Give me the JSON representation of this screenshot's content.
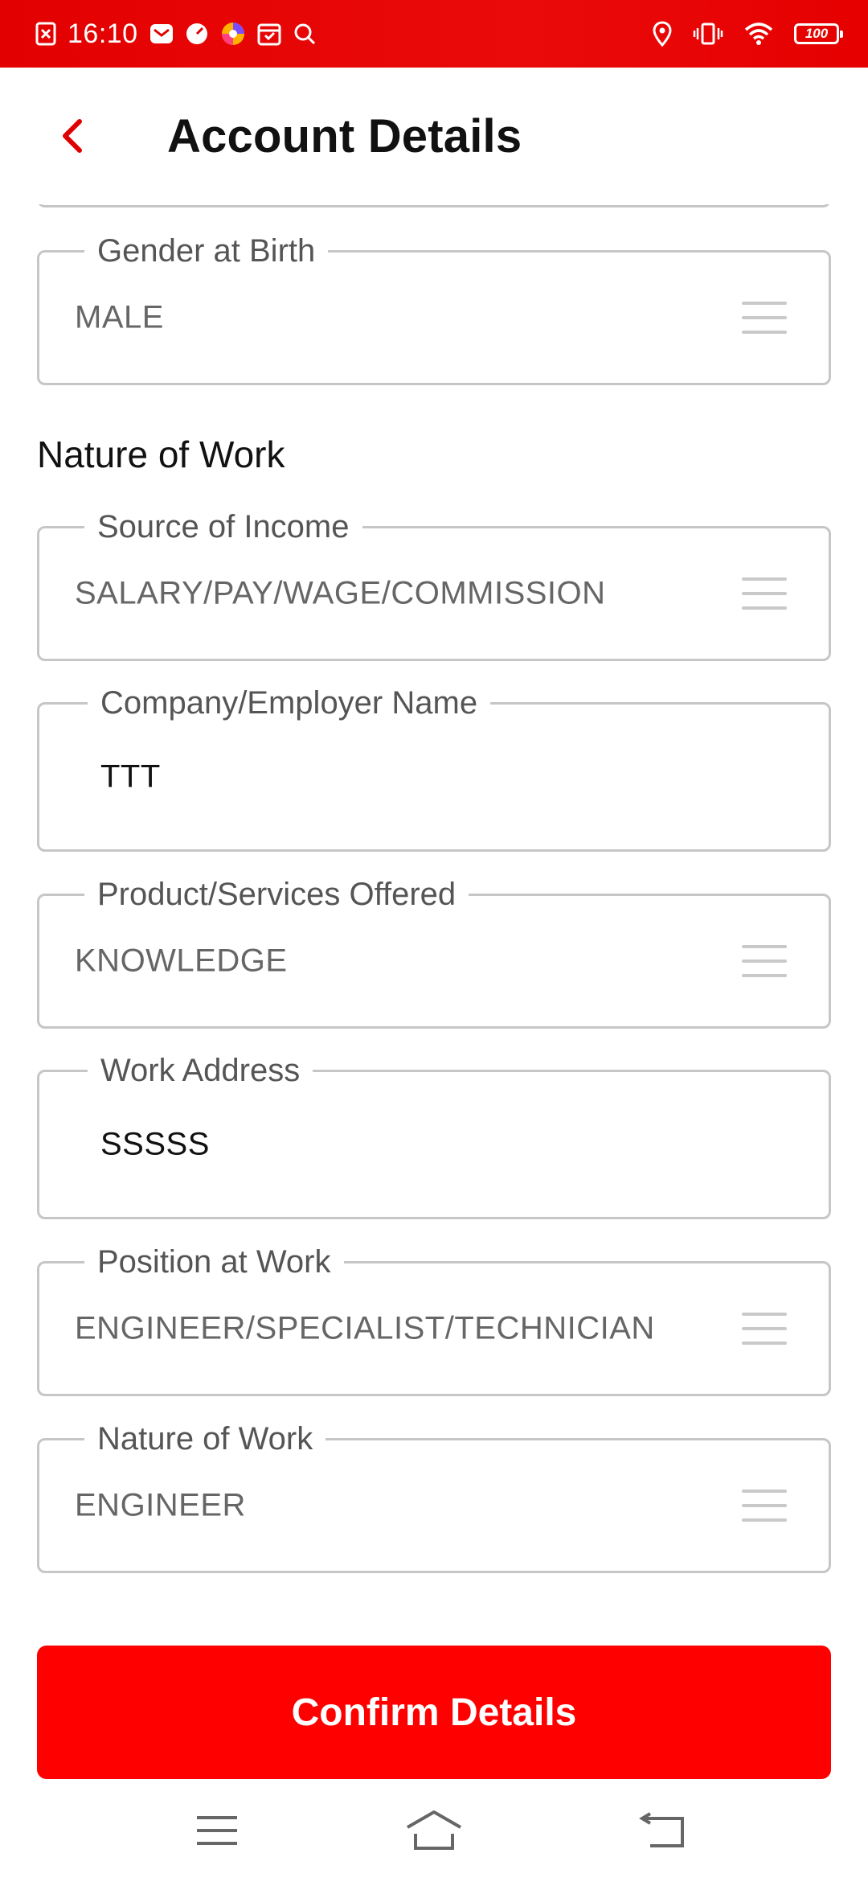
{
  "status_bar": {
    "time": "16:10",
    "battery": "100",
    "icons": [
      "notification-x-icon",
      "mail-icon",
      "speedometer-icon",
      "browser-icon",
      "calendar-icon",
      "search-icon",
      "location-icon",
      "vibrate-icon",
      "wifi-icon",
      "battery-icon"
    ]
  },
  "header": {
    "title": "Account Details",
    "back_icon": "chevron-left-icon"
  },
  "form": {
    "gender": {
      "label": "Gender at Birth",
      "value": "MALE"
    },
    "section_title": "Nature of Work",
    "source_of_income": {
      "label": "Source of Income",
      "value": "SALARY/PAY/WAGE/COMMISSION"
    },
    "company_name": {
      "label": "Company/Employer Name",
      "value": "TTT"
    },
    "products_services": {
      "label": "Product/Services Offered",
      "value": "KNOWLEDGE"
    },
    "work_address": {
      "label": "Work Address",
      "value": "SSSSS"
    },
    "position": {
      "label": "Position at Work",
      "value": "ENGINEER/SPECIALIST/TECHNICIAN"
    },
    "nature_of_work": {
      "label": "Nature of Work",
      "value": "ENGINEER"
    }
  },
  "confirm_button": {
    "label": "Confirm Details"
  },
  "colors": {
    "accent": "#ff0000",
    "status_bar": "#e60000",
    "border": "#c6c6c6"
  },
  "nav_bar": {
    "icons": [
      "menu-icon",
      "home-icon",
      "back-icon"
    ]
  }
}
